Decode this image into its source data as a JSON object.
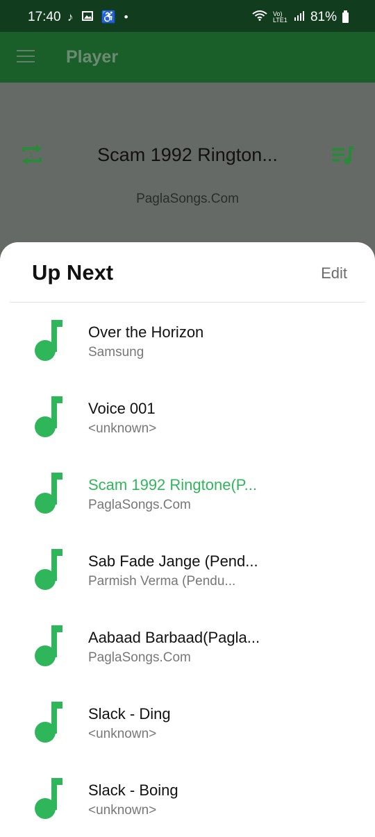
{
  "status_bar": {
    "time": "17:40",
    "left_icons": [
      "music-note-icon",
      "image-icon",
      "accessibility-icon",
      "dot-icon"
    ],
    "network_label": "Vo) LTE1",
    "battery": "81%"
  },
  "app_bar": {
    "title": "Player",
    "menu_icon": "menu-icon"
  },
  "now_playing": {
    "title": "Scam 1992 Rington...",
    "artist": "PaglaSongs.Com",
    "accent_color": "#2a8a3a"
  },
  "up_next": {
    "title": "Up Next",
    "edit_label": "Edit",
    "accent_color": "#2fb65a",
    "items": [
      {
        "title": "Over the Horizon",
        "artist": "Samsung",
        "active": false
      },
      {
        "title": "Voice 001",
        "artist": "<unknown>",
        "active": false
      },
      {
        "title": "Scam 1992 Ringtone(P...",
        "artist": "PaglaSongs.Com",
        "active": true
      },
      {
        "title": "Sab Fade Jange (Pend...",
        "artist": "Parmish Verma (Pendu...",
        "active": false
      },
      {
        "title": "Aabaad Barbaad(Pagla...",
        "artist": "PaglaSongs.Com",
        "active": false
      },
      {
        "title": "Slack - Ding",
        "artist": "<unknown>",
        "active": false
      },
      {
        "title": "Slack - Boing",
        "artist": "<unknown>",
        "active": false
      }
    ]
  }
}
